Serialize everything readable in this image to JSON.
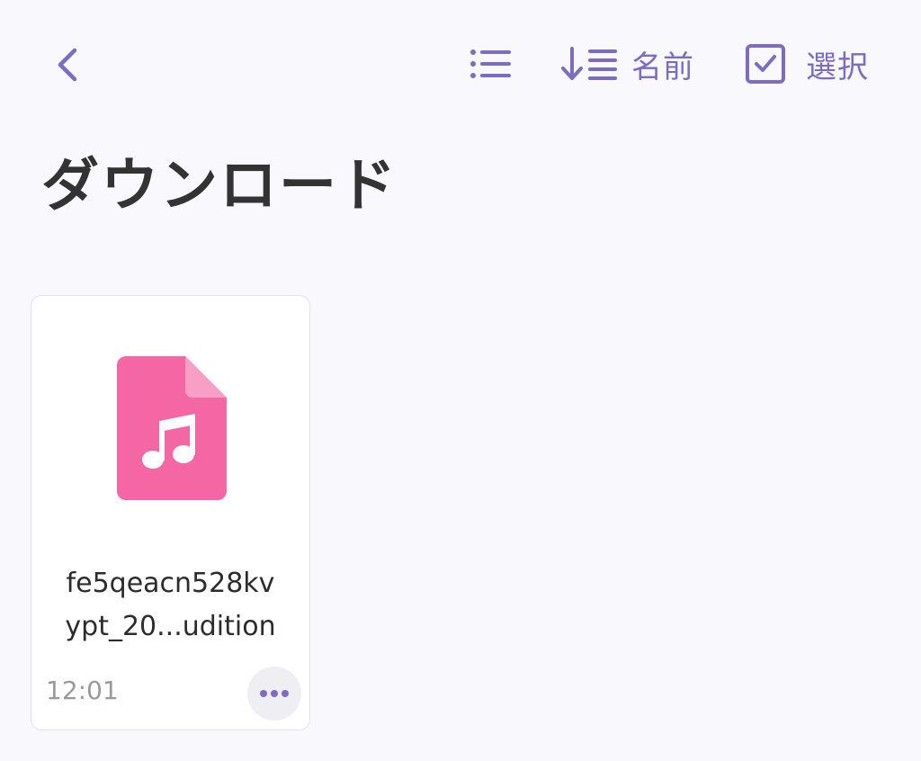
{
  "toolbar": {
    "back_icon": "chevron-left-icon",
    "view_icon": "list-icon",
    "sort_icon": "sort-descending-icon",
    "sort_label": "名前",
    "select_icon": "checkbox-checked-icon",
    "select_label": "選択"
  },
  "page": {
    "title": "ダウンロード"
  },
  "files": [
    {
      "icon": "audio-file-icon",
      "name_line1": "fe5qeacn528kv",
      "name_line2": "ypt_20...udition",
      "time": "12:01",
      "more_icon": "more-horizontal-icon"
    }
  ],
  "colors": {
    "accent": "#7c6cc4",
    "file_icon": "#f566a4",
    "file_icon_fold": "#f99fc6",
    "background": "#f9f8fc"
  }
}
